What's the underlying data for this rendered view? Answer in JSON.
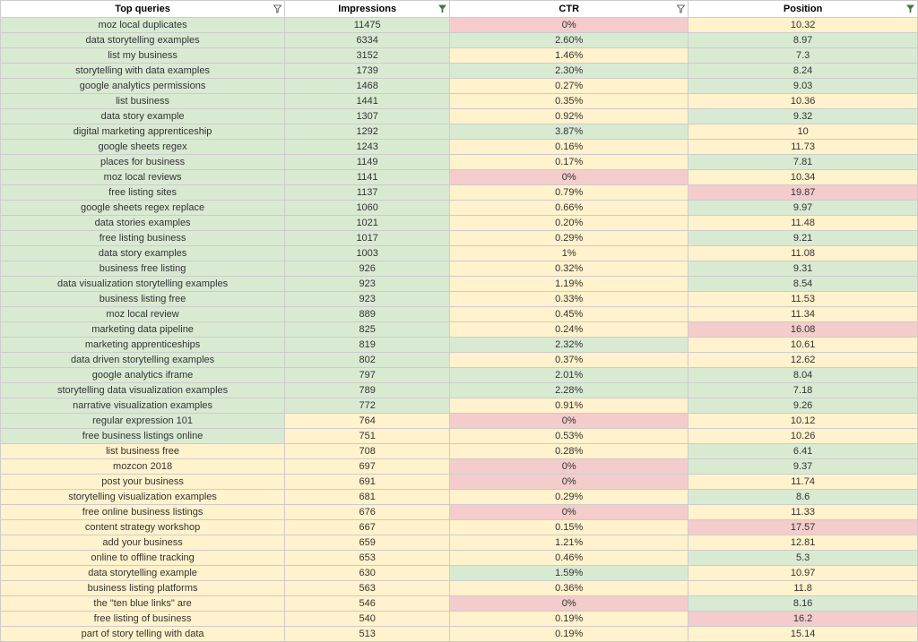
{
  "headers": {
    "query": "Top queries",
    "impressions": "Impressions",
    "ctr": "CTR",
    "position": "Position"
  },
  "filter_indicators": {
    "query": "outline",
    "impressions": "solid",
    "ctr": "outline",
    "position": "solid"
  },
  "rows": [
    {
      "query": "moz local duplicates",
      "impressions": "11475",
      "ctr": "0%",
      "position": "10.32",
      "cls": {
        "q": "g",
        "i": "g",
        "ct": "r",
        "p": "y"
      }
    },
    {
      "query": "data storytelling examples",
      "impressions": "6334",
      "ctr": "2.60%",
      "position": "8.97",
      "cls": {
        "q": "g",
        "i": "g",
        "ct": "g",
        "p": "g"
      }
    },
    {
      "query": "list my business",
      "impressions": "3152",
      "ctr": "1.46%",
      "position": "7.3",
      "cls": {
        "q": "g",
        "i": "g",
        "ct": "y",
        "p": "g"
      }
    },
    {
      "query": "storytelling with data examples",
      "impressions": "1739",
      "ctr": "2.30%",
      "position": "8.24",
      "cls": {
        "q": "g",
        "i": "g",
        "ct": "g",
        "p": "g"
      }
    },
    {
      "query": "google analytics permissions",
      "impressions": "1468",
      "ctr": "0.27%",
      "position": "9.03",
      "cls": {
        "q": "g",
        "i": "g",
        "ct": "y",
        "p": "g"
      }
    },
    {
      "query": "list business",
      "impressions": "1441",
      "ctr": "0.35%",
      "position": "10.36",
      "cls": {
        "q": "g",
        "i": "g",
        "ct": "y",
        "p": "y"
      }
    },
    {
      "query": "data story example",
      "impressions": "1307",
      "ctr": "0.92%",
      "position": "9.32",
      "cls": {
        "q": "g",
        "i": "g",
        "ct": "y",
        "p": "g"
      }
    },
    {
      "query": "digital marketing apprenticeship",
      "impressions": "1292",
      "ctr": "3.87%",
      "position": "10",
      "cls": {
        "q": "g",
        "i": "g",
        "ct": "g",
        "p": "y"
      }
    },
    {
      "query": "google sheets regex",
      "impressions": "1243",
      "ctr": "0.16%",
      "position": "11.73",
      "cls": {
        "q": "g",
        "i": "g",
        "ct": "y",
        "p": "y"
      }
    },
    {
      "query": "places for business",
      "impressions": "1149",
      "ctr": "0.17%",
      "position": "7.81",
      "cls": {
        "q": "g",
        "i": "g",
        "ct": "y",
        "p": "g"
      }
    },
    {
      "query": "moz local reviews",
      "impressions": "1141",
      "ctr": "0%",
      "position": "10.34",
      "cls": {
        "q": "g",
        "i": "g",
        "ct": "r",
        "p": "y"
      }
    },
    {
      "query": "free listing sites",
      "impressions": "1137",
      "ctr": "0.79%",
      "position": "19.87",
      "cls": {
        "q": "g",
        "i": "g",
        "ct": "y",
        "p": "r"
      }
    },
    {
      "query": "google sheets regex replace",
      "impressions": "1060",
      "ctr": "0.66%",
      "position": "9.97",
      "cls": {
        "q": "g",
        "i": "g",
        "ct": "y",
        "p": "g"
      }
    },
    {
      "query": "data stories examples",
      "impressions": "1021",
      "ctr": "0.20%",
      "position": "11.48",
      "cls": {
        "q": "g",
        "i": "g",
        "ct": "y",
        "p": "y"
      }
    },
    {
      "query": "free listing business",
      "impressions": "1017",
      "ctr": "0.29%",
      "position": "9.21",
      "cls": {
        "q": "g",
        "i": "g",
        "ct": "y",
        "p": "g"
      }
    },
    {
      "query": "data story examples",
      "impressions": "1003",
      "ctr": "1%",
      "position": "11.08",
      "cls": {
        "q": "g",
        "i": "g",
        "ct": "y",
        "p": "y"
      }
    },
    {
      "query": "business free listing",
      "impressions": "926",
      "ctr": "0.32%",
      "position": "9.31",
      "cls": {
        "q": "g",
        "i": "g",
        "ct": "y",
        "p": "g"
      }
    },
    {
      "query": "data visualization storytelling examples",
      "impressions": "923",
      "ctr": "1.19%",
      "position": "8.54",
      "cls": {
        "q": "g",
        "i": "g",
        "ct": "y",
        "p": "g"
      }
    },
    {
      "query": "business listing free",
      "impressions": "923",
      "ctr": "0.33%",
      "position": "11.53",
      "cls": {
        "q": "g",
        "i": "g",
        "ct": "y",
        "p": "y"
      }
    },
    {
      "query": "moz local review",
      "impressions": "889",
      "ctr": "0.45%",
      "position": "11.34",
      "cls": {
        "q": "g",
        "i": "g",
        "ct": "y",
        "p": "y"
      }
    },
    {
      "query": "marketing data pipeline",
      "impressions": "825",
      "ctr": "0.24%",
      "position": "16.08",
      "cls": {
        "q": "g",
        "i": "g",
        "ct": "y",
        "p": "r"
      }
    },
    {
      "query": "marketing apprenticeships",
      "impressions": "819",
      "ctr": "2.32%",
      "position": "10.61",
      "cls": {
        "q": "g",
        "i": "g",
        "ct": "g",
        "p": "y"
      }
    },
    {
      "query": "data driven storytelling examples",
      "impressions": "802",
      "ctr": "0.37%",
      "position": "12.62",
      "cls": {
        "q": "g",
        "i": "g",
        "ct": "y",
        "p": "y"
      }
    },
    {
      "query": "google analytics iframe",
      "impressions": "797",
      "ctr": "2.01%",
      "position": "8.04",
      "cls": {
        "q": "g",
        "i": "g",
        "ct": "g",
        "p": "g"
      }
    },
    {
      "query": "storytelling data visualization examples",
      "impressions": "789",
      "ctr": "2.28%",
      "position": "7.18",
      "cls": {
        "q": "g",
        "i": "g",
        "ct": "g",
        "p": "g"
      }
    },
    {
      "query": "narrative visualization examples",
      "impressions": "772",
      "ctr": "0.91%",
      "position": "9.26",
      "cls": {
        "q": "g",
        "i": "g",
        "ct": "y",
        "p": "g"
      }
    },
    {
      "query": "regular expression 101",
      "impressions": "764",
      "ctr": "0%",
      "position": "10.12",
      "cls": {
        "q": "g",
        "i": "y",
        "ct": "r",
        "p": "y"
      }
    },
    {
      "query": "free business listings online",
      "impressions": "751",
      "ctr": "0.53%",
      "position": "10.26",
      "cls": {
        "q": "g",
        "i": "y",
        "ct": "y",
        "p": "y"
      }
    },
    {
      "query": "list business free",
      "impressions": "708",
      "ctr": "0.28%",
      "position": "6.41",
      "cls": {
        "q": "y",
        "i": "y",
        "ct": "y",
        "p": "g"
      }
    },
    {
      "query": "mozcon 2018",
      "impressions": "697",
      "ctr": "0%",
      "position": "9.37",
      "cls": {
        "q": "y",
        "i": "y",
        "ct": "r",
        "p": "g"
      }
    },
    {
      "query": "post your business",
      "impressions": "691",
      "ctr": "0%",
      "position": "11.74",
      "cls": {
        "q": "y",
        "i": "y",
        "ct": "r",
        "p": "y"
      }
    },
    {
      "query": "storytelling visualization examples",
      "impressions": "681",
      "ctr": "0.29%",
      "position": "8.6",
      "cls": {
        "q": "y",
        "i": "y",
        "ct": "y",
        "p": "g"
      }
    },
    {
      "query": "free online business listings",
      "impressions": "676",
      "ctr": "0%",
      "position": "11.33",
      "cls": {
        "q": "y",
        "i": "y",
        "ct": "r",
        "p": "y"
      }
    },
    {
      "query": "content strategy workshop",
      "impressions": "667",
      "ctr": "0.15%",
      "position": "17.57",
      "cls": {
        "q": "y",
        "i": "y",
        "ct": "y",
        "p": "r"
      }
    },
    {
      "query": "add your business",
      "impressions": "659",
      "ctr": "1.21%",
      "position": "12.81",
      "cls": {
        "q": "y",
        "i": "y",
        "ct": "y",
        "p": "y"
      }
    },
    {
      "query": "online to offline tracking",
      "impressions": "653",
      "ctr": "0.46%",
      "position": "5.3",
      "cls": {
        "q": "y",
        "i": "y",
        "ct": "y",
        "p": "g"
      }
    },
    {
      "query": "data storytelling example",
      "impressions": "630",
      "ctr": "1.59%",
      "position": "10.97",
      "cls": {
        "q": "y",
        "i": "y",
        "ct": "g",
        "p": "y"
      }
    },
    {
      "query": "business listing platforms",
      "impressions": "563",
      "ctr": "0.36%",
      "position": "11.8",
      "cls": {
        "q": "y",
        "i": "y",
        "ct": "y",
        "p": "y"
      }
    },
    {
      "query": "the \"ten blue links\" are",
      "impressions": "546",
      "ctr": "0%",
      "position": "8.16",
      "cls": {
        "q": "y",
        "i": "y",
        "ct": "r",
        "p": "g"
      }
    },
    {
      "query": "free listing of business",
      "impressions": "540",
      "ctr": "0.19%",
      "position": "16.2",
      "cls": {
        "q": "y",
        "i": "y",
        "ct": "y",
        "p": "r"
      }
    },
    {
      "query": "part of story telling with data",
      "impressions": "513",
      "ctr": "0.19%",
      "position": "15.14",
      "cls": {
        "q": "y",
        "i": "y",
        "ct": "y",
        "p": "y"
      }
    }
  ]
}
